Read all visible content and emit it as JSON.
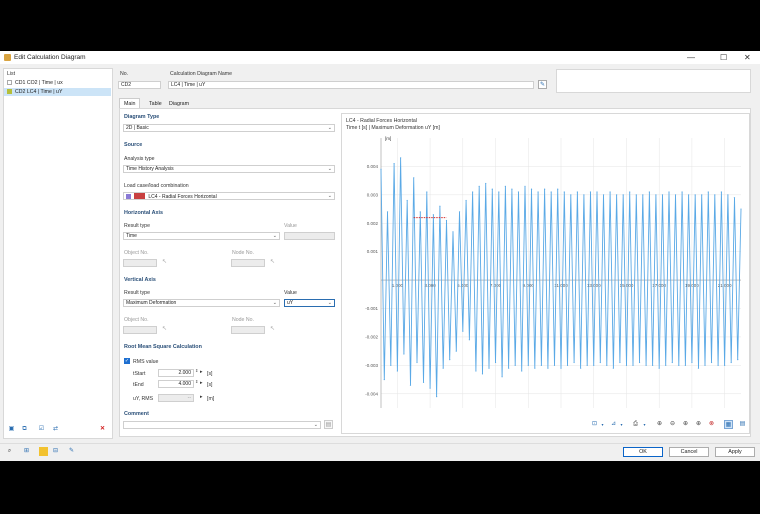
{
  "window": {
    "title": "Edit Calculation Diagram",
    "minimize": "—",
    "maximize": "☐",
    "close": "✕"
  },
  "list": {
    "header": "List",
    "items": [
      {
        "code": "CD1",
        "label": "CO2 | Time | ux",
        "color": "#ffffff",
        "selected": false
      },
      {
        "code": "CD2",
        "label": "LC4 | Time | uY",
        "color": "#b5bf3a",
        "selected": true
      }
    ]
  },
  "no": {
    "label": "No.",
    "value": "CD2"
  },
  "name": {
    "label": "Calculation Diagram Name",
    "value": "LC4 | Time | uY"
  },
  "tabs": [
    "Main",
    "Table",
    "Diagram"
  ],
  "main": {
    "diagram_type": {
      "header": "Diagram Type",
      "value": "2D | Basic"
    },
    "source": {
      "header": "Source",
      "analysis_label": "Analysis type",
      "analysis_value": "Time History Analysis",
      "loadcase_label": "Load case/load combination",
      "loadcase_tag": "LC4",
      "loadcase_value": "LC4 - Radial Forces Horizontal"
    },
    "horizontal_axis": {
      "header": "Horizontal Axis",
      "result_type_label": "Result type",
      "result_type_value": "Time",
      "value_label": "Value",
      "object_label": "Object No.",
      "node_label": "Node No."
    },
    "vertical_axis": {
      "header": "Vertical Axis",
      "result_type_label": "Result type",
      "result_type_value": "Maximum Deformation",
      "value_label": "Value",
      "value_value": "uY",
      "object_label": "Object No.",
      "node_label": "Node No."
    },
    "rms": {
      "header": "Root Mean Square Calculation",
      "checkbox_label": "RMS value",
      "tstart_label": "tStart",
      "tstart_value": "2.000",
      "tend_label": "tEnd",
      "tend_value": "4.000",
      "unit_s": "[s]",
      "urms_label": "uY, RMS",
      "urms_value": "--",
      "unit_m": "[m]"
    },
    "comment": {
      "header": "Comment"
    }
  },
  "chart_header": {
    "title": "LC4 - Radial Forces Horizontal",
    "subtitle": "Time t [s] | Maximum Deformation uY [m]"
  },
  "chart_data": {
    "type": "line",
    "y_unit_label": "[m]",
    "xlim": [
      0,
      22
    ],
    "ylim": [
      -0.0045,
      0.005
    ],
    "x_ticks": [
      "1.000",
      "3.000",
      "5.000",
      "7.000",
      "9.000",
      "11.000",
      "13.000",
      "15.000",
      "17.000",
      "19.000",
      "21.000"
    ],
    "x_tick_values": [
      1,
      3,
      5,
      7,
      9,
      11,
      13,
      15,
      17,
      19,
      21
    ],
    "y_ticks": [
      "0.004",
      "0.003",
      "0.002",
      "0.001",
      "-0.001",
      "-0.002",
      "-0.003",
      "-0.004"
    ],
    "y_tick_values": [
      0.004,
      0.003,
      0.002,
      0.001,
      -0.001,
      -0.002,
      -0.003,
      -0.004
    ],
    "series": [
      {
        "color": "#5aa9e6",
        "x": [
          0,
          0.2,
          0.4,
          0.6,
          0.8,
          1,
          1.2,
          1.4,
          1.6,
          1.8,
          2,
          2.2,
          2.4,
          2.6,
          2.8,
          3,
          3.2,
          3.4,
          3.6,
          3.8,
          4,
          4.2,
          4.4,
          4.6,
          4.8,
          5,
          5.2,
          5.4,
          5.6,
          5.8,
          6,
          6.2,
          6.4,
          6.6,
          6.8,
          7,
          7.2,
          7.4,
          7.6,
          7.8,
          8,
          8.2,
          8.4,
          8.6,
          8.8,
          9,
          9.2,
          9.4,
          9.6,
          9.8,
          10,
          10.2,
          10.4,
          10.6,
          10.8,
          11,
          11.2,
          11.4,
          11.6,
          11.8,
          12,
          12.2,
          12.4,
          12.6,
          12.8,
          13,
          13.2,
          13.4,
          13.6,
          13.8,
          14,
          14.2,
          14.4,
          14.6,
          14.8,
          15,
          15.2,
          15.4,
          15.6,
          15.8,
          16,
          16.2,
          16.4,
          16.6,
          16.8,
          17,
          17.2,
          17.4,
          17.6,
          17.8,
          18,
          18.2,
          18.4,
          18.6,
          18.8,
          19,
          19.2,
          19.4,
          19.6,
          19.8,
          20,
          20.2,
          20.4,
          20.6,
          20.8,
          21,
          21.2,
          21.4,
          21.6,
          21.8,
          22
        ],
        "y": [
          0.0039,
          -0.0035,
          0.0024,
          -0.003,
          0.0041,
          -0.0032,
          0.0043,
          -0.0026,
          0.0028,
          -0.0037,
          0.0036,
          -0.0029,
          0.0024,
          -0.0036,
          0.0031,
          -0.0038,
          0.0023,
          -0.0041,
          0.0026,
          -0.0031,
          0.0021,
          -0.0028,
          0.0017,
          -0.0025,
          0.0024,
          -0.0018,
          0.0028,
          -0.0021,
          0.0031,
          -0.0032,
          0.0033,
          -0.0033,
          0.0034,
          -0.0031,
          0.0032,
          -0.0029,
          0.0031,
          -0.0034,
          0.0033,
          -0.0031,
          0.0032,
          -0.003,
          0.0031,
          -0.0032,
          0.0033,
          -0.003,
          0.0032,
          -0.0031,
          0.0031,
          -0.003,
          0.0032,
          -0.0031,
          0.0031,
          -0.003,
          0.0032,
          -0.0031,
          0.0031,
          -0.003,
          0.003,
          -0.0029,
          0.0031,
          -0.0031,
          0.003,
          -0.003,
          0.0031,
          -0.003,
          0.0031,
          -0.0029,
          0.003,
          -0.003,
          0.0031,
          -0.0031,
          0.003,
          -0.0029,
          0.003,
          -0.003,
          0.0031,
          -0.003,
          0.003,
          -0.0029,
          0.003,
          -0.003,
          0.0031,
          -0.003,
          0.003,
          -0.0031,
          0.003,
          -0.003,
          0.0031,
          -0.0029,
          0.003,
          -0.003,
          0.0031,
          -0.003,
          0.003,
          -0.0029,
          0.003,
          -0.0031,
          0.003,
          -0.003,
          0.0031,
          -0.0029,
          0.003,
          -0.003,
          0.0031,
          -0.003,
          0.003,
          -0.0029,
          0.0029,
          -0.0028,
          0.0025
        ]
      }
    ],
    "rms_marker": {
      "x": [
        2.0,
        4.0
      ],
      "y": 0.0022,
      "color": "#d32f2f"
    }
  },
  "buttons": {
    "ok": "OK",
    "cancel": "Cancel",
    "apply": "Apply"
  },
  "colors": {
    "accent": "#2a4f78",
    "selection": "#cce4f7",
    "series": "#5aa9e6"
  }
}
